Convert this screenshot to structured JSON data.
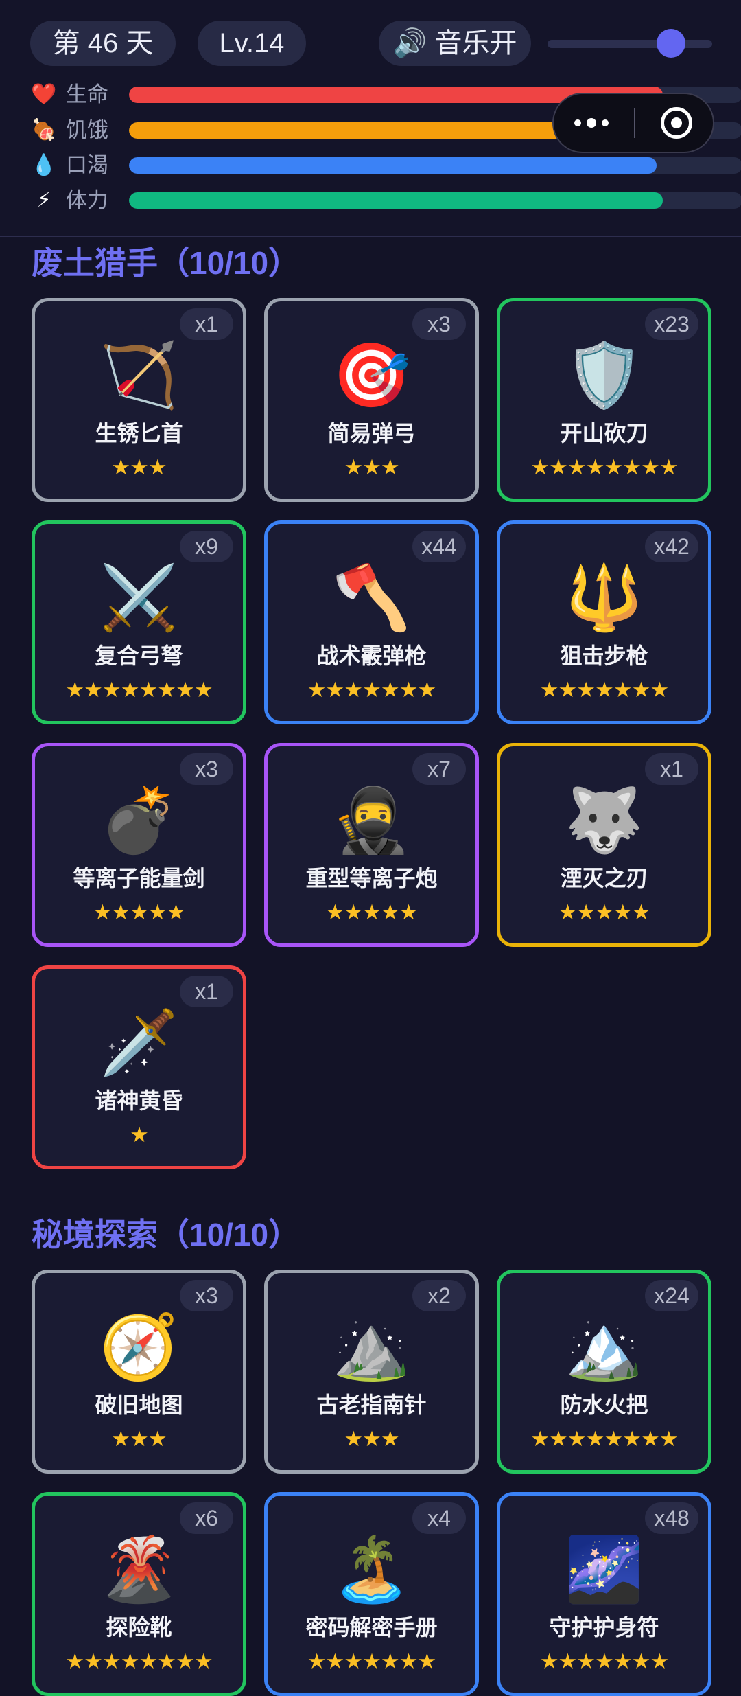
{
  "header": {
    "day": "第 46 天",
    "level": "Lv.14",
    "music": {
      "icon": "🔊",
      "label": "音乐开"
    },
    "volume": 0.75,
    "stats": [
      {
        "icon": "❤️",
        "icon_name": "heart-icon",
        "label": "生命",
        "value": 0.87,
        "color": "#ef4444"
      },
      {
        "icon": "🍖",
        "icon_name": "meat-icon",
        "label": "饥饿",
        "value": 0.79,
        "color": "#f59e0b"
      },
      {
        "icon": "💧",
        "icon_name": "water-drop-icon",
        "label": "口渴",
        "value": 0.86,
        "color": "#3b82f6"
      },
      {
        "icon": "⚡",
        "icon_name": "lightning-icon",
        "label": "体力",
        "value": 0.87,
        "color": "#10b981"
      }
    ]
  },
  "rarity_colors": {
    "common": "#9ca3af",
    "uncommon": "#22c55e",
    "rare": "#3b82f6",
    "epic": "#a855f7",
    "legendary": "#eab308",
    "mythic": "#ef4444"
  },
  "sections": [
    {
      "title": "废土猎手（10/10）",
      "items": [
        {
          "name": "生锈匕首",
          "emoji": "🏹",
          "icon_name": "bow-and-arrow-icon",
          "count": "x1",
          "stars": 3,
          "rarity": "common"
        },
        {
          "name": "简易弹弓",
          "emoji": "🎯",
          "icon_name": "target-icon",
          "count": "x3",
          "stars": 3,
          "rarity": "common"
        },
        {
          "name": "开山砍刀",
          "emoji": "🛡️",
          "icon_name": "shield-icon",
          "count": "x23",
          "stars": 8,
          "rarity": "uncommon"
        },
        {
          "name": "复合弓弩",
          "emoji": "⚔️",
          "icon_name": "crossed-swords-icon",
          "count": "x9",
          "stars": 8,
          "rarity": "uncommon"
        },
        {
          "name": "战术霰弹枪",
          "emoji": "🪓",
          "icon_name": "axe-icon",
          "count": "x44",
          "stars": 7,
          "rarity": "rare"
        },
        {
          "name": "狙击步枪",
          "emoji": "🔱",
          "icon_name": "trident-icon",
          "count": "x42",
          "stars": 7,
          "rarity": "rare"
        },
        {
          "name": "等离子能量剑",
          "emoji": "💣",
          "icon_name": "bomb-icon",
          "count": "x3",
          "stars": 5,
          "rarity": "epic"
        },
        {
          "name": "重型等离子炮",
          "emoji": "🥷",
          "icon_name": "ninja-icon",
          "count": "x7",
          "stars": 5,
          "rarity": "epic"
        },
        {
          "name": "湮灭之刃",
          "emoji": "🐺",
          "icon_name": "wolf-icon",
          "count": "x1",
          "stars": 5,
          "rarity": "legendary"
        },
        {
          "name": "诸神黄昏",
          "emoji": "🗡️",
          "icon_name": "dagger-icon",
          "count": "x1",
          "stars": 1,
          "rarity": "mythic"
        }
      ]
    },
    {
      "title": "秘境探索（10/10）",
      "items": [
        {
          "name": "破旧地图",
          "emoji": "🧭",
          "icon_name": "compass-icon",
          "count": "x3",
          "stars": 3,
          "rarity": "common"
        },
        {
          "name": "古老指南针",
          "emoji": "⛰️",
          "icon_name": "mountain-icon",
          "count": "x2",
          "stars": 3,
          "rarity": "common"
        },
        {
          "name": "防水火把",
          "emoji": "🏔️",
          "icon_name": "snow-mountain-icon",
          "count": "x24",
          "stars": 8,
          "rarity": "uncommon"
        },
        {
          "name": "探险靴",
          "emoji": "🌋",
          "icon_name": "volcano-icon",
          "count": "x6",
          "stars": 8,
          "rarity": "uncommon"
        },
        {
          "name": "密码解密手册",
          "emoji": "🏝️",
          "icon_name": "island-icon",
          "count": "x4",
          "stars": 7,
          "rarity": "rare"
        },
        {
          "name": "守护护身符",
          "emoji": "🌌",
          "icon_name": "galaxy-icon",
          "count": "x48",
          "stars": 7,
          "rarity": "rare"
        }
      ]
    }
  ]
}
